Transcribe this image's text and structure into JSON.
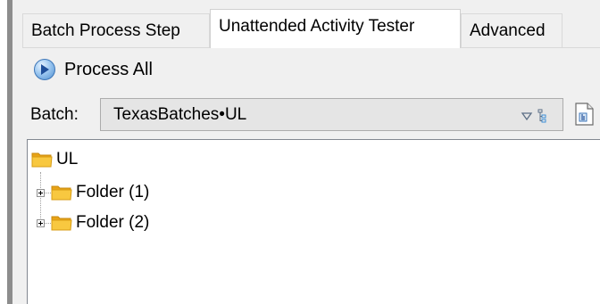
{
  "tabs": [
    {
      "label": "Batch Process Step",
      "active": false
    },
    {
      "label": "Unattended Activity Tester",
      "active": true
    },
    {
      "label": "Advanced",
      "active": false
    }
  ],
  "toolbar": {
    "process_all_label": "Process All",
    "process_all_icon": "play-circle-icon"
  },
  "batch": {
    "label": "Batch:",
    "selected_value": "TexasBatches•UL",
    "dropdown_icon": "filter-tree-icon",
    "side_icon": "document-icon"
  },
  "tree": {
    "root": {
      "label": "UL",
      "icon": "folder-icon"
    },
    "children": [
      {
        "label": "Folder (1)",
        "icon": "folder-icon",
        "expandable": true
      },
      {
        "label": "Folder (2)",
        "icon": "folder-icon",
        "expandable": true
      }
    ]
  },
  "colors": {
    "folder": "#f2b92d",
    "play_icon": "#4f8fd0",
    "active_tab_bg": "#ffffff",
    "window_bg": "#f0f0f0"
  }
}
